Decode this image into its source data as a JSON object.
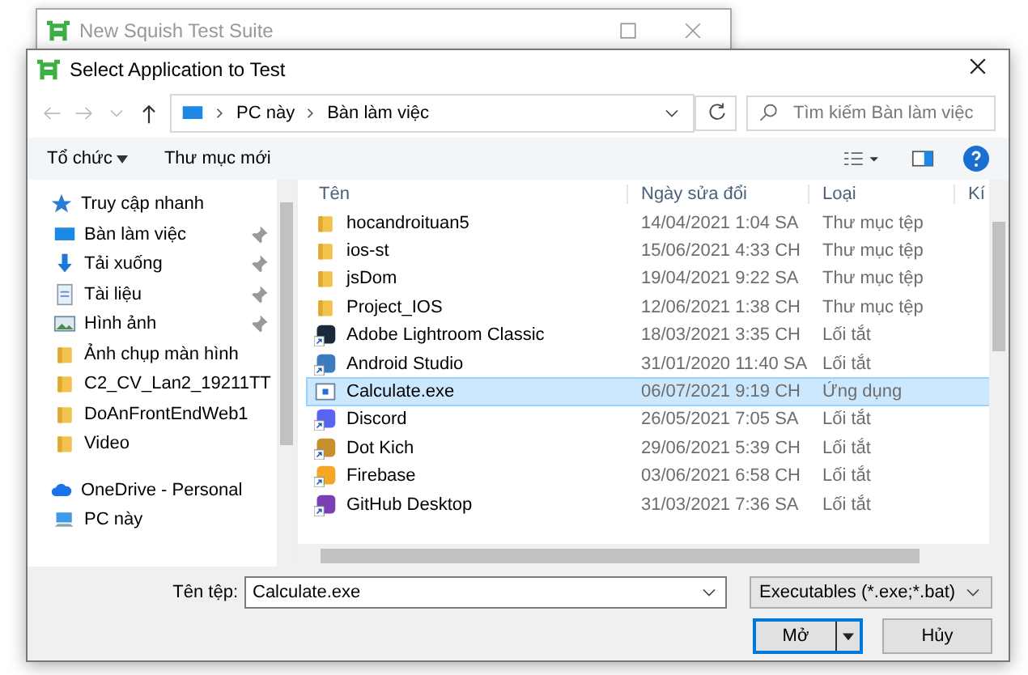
{
  "background_window": {
    "title": "New Squish Test Suite"
  },
  "dialog": {
    "title": "Select Application to Test",
    "breadcrumb": [
      "PC này",
      "Bàn làm việc"
    ],
    "search": {
      "placeholder": "Tìm kiếm Bàn làm việc"
    },
    "toolbar": {
      "organize": "Tổ chức",
      "new_folder": "Thư mục mới"
    },
    "nav_items": [
      {
        "label": "Truy cập nhanh",
        "kind": "star",
        "pinned": false
      },
      {
        "label": "Bàn làm việc",
        "kind": "desktop",
        "pinned": true
      },
      {
        "label": "Tải xuống",
        "kind": "download",
        "pinned": true
      },
      {
        "label": "Tài liệu",
        "kind": "document",
        "pinned": true
      },
      {
        "label": "Hình ảnh",
        "kind": "image",
        "pinned": true
      },
      {
        "label": "Ảnh chụp màn hình",
        "kind": "folder",
        "pinned": false
      },
      {
        "label": "C2_CV_Lan2_19211TT",
        "kind": "folder",
        "pinned": false
      },
      {
        "label": "DoAnFrontEndWeb1",
        "kind": "folder",
        "pinned": false
      },
      {
        "label": "Video",
        "kind": "folder",
        "pinned": false
      },
      {
        "label": "OneDrive - Personal",
        "kind": "cloud",
        "pinned": false
      },
      {
        "label": "PC này",
        "kind": "computer",
        "pinned": false
      }
    ],
    "columns": [
      "Tên",
      "Ngày sửa đổi",
      "Loại",
      "Kí"
    ],
    "files": [
      {
        "name": "hocandroituan5",
        "date": "14/04/2021 1:04 SA",
        "type": "Thư mục tệp",
        "kind": "folder",
        "selected": false
      },
      {
        "name": "ios-st",
        "date": "15/06/2021 4:33 CH",
        "type": "Thư mục tệp",
        "kind": "folder",
        "selected": false
      },
      {
        "name": "jsDom",
        "date": "19/04/2021 9:22 SA",
        "type": "Thư mục tệp",
        "kind": "folder",
        "selected": false
      },
      {
        "name": "Project_IOS",
        "date": "12/06/2021 1:38 CH",
        "type": "Thư mục tệp",
        "kind": "folder",
        "selected": false
      },
      {
        "name": "Adobe Lightroom Classic",
        "date": "18/03/2021 3:35 CH",
        "type": "Lối tắt",
        "kind": "shortcut",
        "color": "#1b2a3a",
        "selected": false
      },
      {
        "name": "Android Studio",
        "date": "31/01/2020 11:40 SA",
        "type": "Lối tắt",
        "kind": "shortcut",
        "color": "#3b7bbf",
        "selected": false
      },
      {
        "name": "Calculate.exe",
        "date": "06/07/2021 9:19 CH",
        "type": "Ứng dụng",
        "kind": "app",
        "selected": true
      },
      {
        "name": "Discord",
        "date": "26/05/2021 7:05 SA",
        "type": "Lối tắt",
        "kind": "shortcut",
        "color": "#5865f2",
        "selected": false
      },
      {
        "name": "Dot Kich",
        "date": "29/06/2021 5:39 CH",
        "type": "Lối tắt",
        "kind": "shortcut",
        "color": "#c8902a",
        "selected": false
      },
      {
        "name": "Firebase",
        "date": "03/06/2021 6:58 CH",
        "type": "Lối tắt",
        "kind": "shortcut",
        "color": "#f5a623",
        "selected": false
      },
      {
        "name": "GitHub Desktop",
        "date": "31/03/2021 7:36 SA",
        "type": "Lối tắt",
        "kind": "shortcut",
        "color": "#7b3fb5",
        "selected": false
      }
    ],
    "file_name": {
      "label": "Tên tệp:",
      "value": "Calculate.exe"
    },
    "filter": "Executables (*.exe;*.bat)",
    "buttons": {
      "open": "Mở",
      "cancel": "Hủy"
    }
  }
}
